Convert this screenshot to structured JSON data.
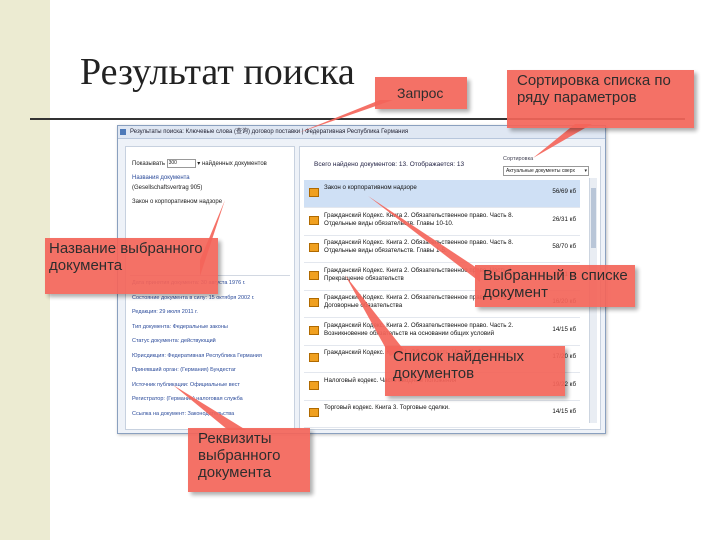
{
  "slide": {
    "title": "Результат поиска"
  },
  "window": {
    "title": "Результаты поиска: Ключевые слова (查询) договор поставки | Федеративная Республика Германия",
    "left_pane": {
      "show_label": "Показывать",
      "show_value": "300",
      "show_suffix": "найденных документов",
      "lines": [
        "Названия документа",
        "(Gesellschaftsvertrag 905)",
        "Закон о корпоративном надзоре"
      ],
      "attributes": [
        "Дата принятия документа: 30 августа 1976 г.",
        "Состояние документа в силу: 15 октября 2002 г.",
        "Редакция: 29 июля 2011 г.",
        "Тип документа: Федеральные законы",
        "Статус документа: действующий",
        "Юрисдикция: Федеративная Республика Германия",
        "Принявший орган: (Германия) Бундестаг",
        "Источник публикации: Официальные вест",
        "Регистратор: (Германия) налоговая служба",
        "Ссылка на документ: Законодательства"
      ]
    },
    "right_pane": {
      "count_text": "Всего найдено документов: 13. Отображается: 13",
      "sort_label": "Сортировка",
      "sort_value": "Актуальные документы сверх",
      "documents": [
        {
          "title": "Закон о корпоративном надзоре",
          "size": "56/69 кб",
          "selected": true
        },
        {
          "title": "Гражданский Кодекс. Книга 2. Обязательственное право. Часть 8. Отдельные виды обязательств. Главы 10-10.",
          "size": "26/31 кб",
          "selected": false
        },
        {
          "title": "Гражданский Кодекс. Книга 2. Обязательственное право. Часть 8. Отдельные виды обязательств. Главы 1-5.",
          "size": "58/70 кб",
          "selected": false
        },
        {
          "title": "Гражданский Кодекс. Книга 2. Обязательственное право. Часть 4. Прекращение обязательств",
          "size": "17/21 кб",
          "selected": false
        },
        {
          "title": "Гражданский Кодекс. Книга 2. Обязательственное право. Часть 3. Договорные обязательства",
          "size": "16/20 кб",
          "selected": false
        },
        {
          "title": "Гражданский Кодекс. Книга 2. Обязательственное право. Часть 2. Возникновение обязательств на основании общих условий",
          "size": "14/15 кб",
          "selected": false
        },
        {
          "title": "Гражданский Кодекс. Книга 1. Общая часть. Часть 1. Содержание",
          "size": "17/20 кб",
          "selected": false
        },
        {
          "title": "Налоговый кодекс. Часть вводные положения",
          "size": "19/22 кб",
          "selected": false
        },
        {
          "title": "Торговый кодекс. Книга 3. Торговые сделки.",
          "size": "14/15 кб",
          "selected": false
        }
      ]
    }
  },
  "callouts": {
    "query": "Запрос",
    "sort": "Сортировка списка по ряду параметров",
    "name": "Название выбранного документа",
    "selected": "Выбранный в списке документ",
    "list": "Список найденных документов",
    "attrs": "Реквизиты выбранного документа"
  },
  "colors": {
    "callout": "#f4655a",
    "side_bar": "#ecebd2",
    "selected_row": "#cfe0f5",
    "doc_icon": "#f0a020"
  }
}
